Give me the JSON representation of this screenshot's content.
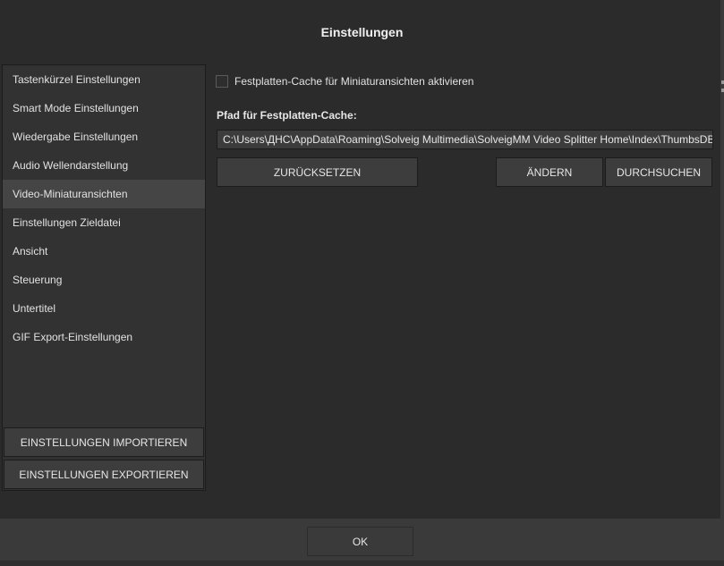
{
  "dialog": {
    "title": "Einstellungen"
  },
  "sidebar": {
    "items": [
      {
        "label": "Tastenkürzel Einstellungen"
      },
      {
        "label": "Smart Mode Einstellungen"
      },
      {
        "label": "Wiedergabe Einstellungen"
      },
      {
        "label": "Audio Wellendarstellung"
      },
      {
        "label": "Video-Miniaturansichten"
      },
      {
        "label": "Einstellungen Zieldatei"
      },
      {
        "label": "Ansicht"
      },
      {
        "label": "Steuerung"
      },
      {
        "label": "Untertitel"
      },
      {
        "label": "GIF Export-Einstellungen"
      }
    ],
    "active_index": 4,
    "import_label": "EINSTELLUNGEN IMPORTIEREN",
    "export_label": "EINSTELLUNGEN EXPORTIEREN"
  },
  "main": {
    "checkbox_label": "Festplatten-Cache für Miniaturansichten aktivieren",
    "checkbox_checked": false,
    "path_label": "Pfad für Festplatten-Cache:",
    "path_value": "C:\\Users\\ДНС\\AppData\\Roaming\\Solveig Multimedia\\SolveigMM Video Splitter Home\\Index\\ThumbsDB",
    "reset_label": "ZURÜCKSETZEN",
    "change_label": "ÄNDERN",
    "browse_label": "DURCHSUCHEN"
  },
  "footer": {
    "ok_label": "OK"
  },
  "colors": {
    "background": "#2b2b2b",
    "panel": "#323232",
    "active_item": "#454545",
    "button": "#3d3d3d",
    "footer": "#3a3a3a"
  }
}
